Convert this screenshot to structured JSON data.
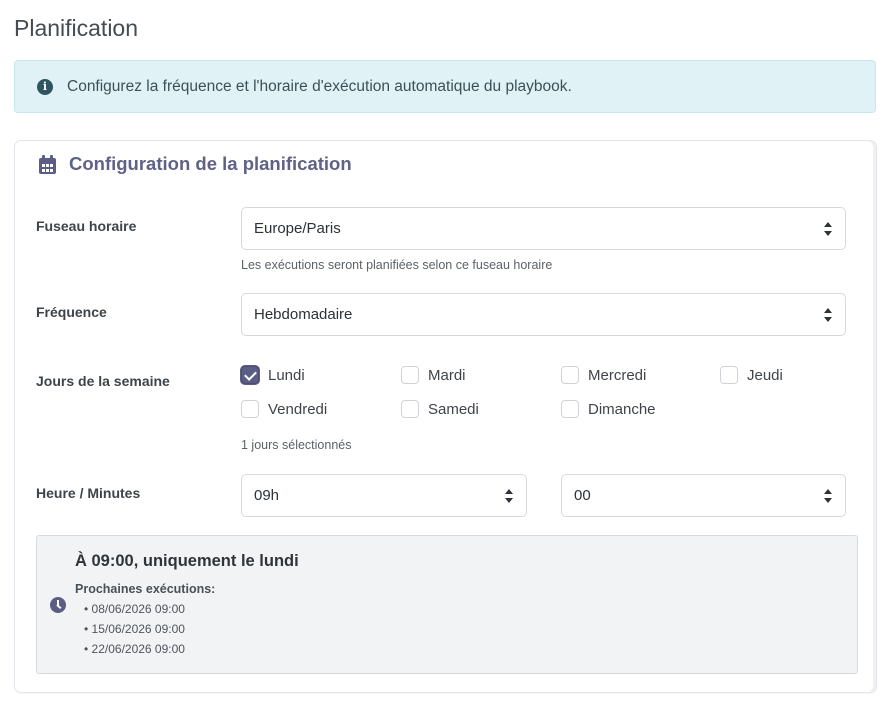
{
  "page": {
    "title": "Planification"
  },
  "alert": {
    "icon": "info-circle-icon",
    "text": "Configurez la fréquence et l'horaire d'exécution automatique du playbook."
  },
  "card": {
    "icon": "calendar-icon",
    "title": "Configuration de la planification"
  },
  "timezone": {
    "label": "Fuseau horaire",
    "value": "Europe/Paris",
    "help": "Les exécutions seront planifiées selon ce fuseau horaire"
  },
  "frequency": {
    "label": "Fréquence",
    "value": "Hebdomadaire"
  },
  "weekdays": {
    "label": "Jours de la semaine",
    "days": [
      {
        "label": "Lundi",
        "checked": true
      },
      {
        "label": "Mardi",
        "checked": false
      },
      {
        "label": "Mercredi",
        "checked": false
      },
      {
        "label": "Jeudi",
        "checked": false
      },
      {
        "label": "Vendredi",
        "checked": false
      },
      {
        "label": "Samedi",
        "checked": false
      },
      {
        "label": "Dimanche",
        "checked": false
      }
    ],
    "selected_count_text": "1 jours sélectionnés"
  },
  "time": {
    "label": "Heure / Minutes",
    "hour": "09h",
    "minute": "00"
  },
  "summary": {
    "icon": "clock-icon",
    "title": "À 09:00, uniquement le lundi",
    "next_label": "Prochaines exécutions:",
    "runs": [
      "• 08/06/2026 09:00",
      "• 15/06/2026 09:00",
      "• 22/06/2026 09:00"
    ]
  },
  "colors": {
    "accent": "#5b5d84",
    "alert_bg": "#e1f2f6"
  }
}
